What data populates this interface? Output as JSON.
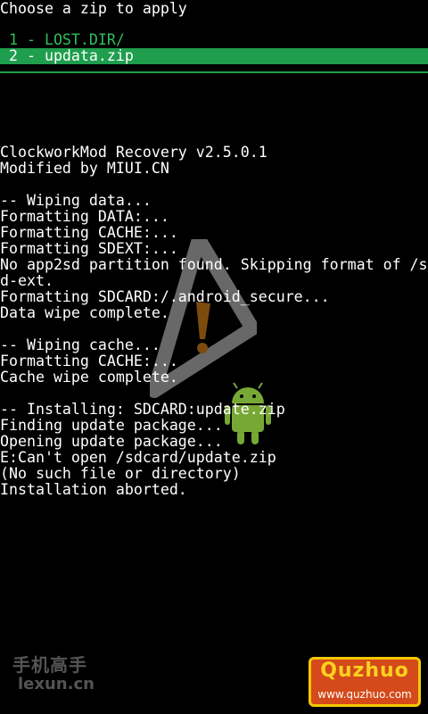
{
  "header": {
    "title": "Choose a zip to apply"
  },
  "menu": {
    "items": [
      {
        "label": " 1 - LOST.DIR/"
      },
      {
        "label": " 2 - updata.zip"
      }
    ],
    "selected_index": 1,
    "colors": {
      "item_text": "#2fbf5c",
      "highlight": "#1f9e4e"
    }
  },
  "log": {
    "lines": [
      "ClockworkMod Recovery v2.5.0.1",
      "Modified by MIUI.CN",
      "",
      "-- Wiping data...",
      "Formatting DATA:...",
      "Formatting CACHE:...",
      "Formatting SDEXT:...",
      "No app2sd partition found. Skipping format of /s",
      "d-ext.",
      "Formatting SDCARD:/.android_secure...",
      "Data wipe complete.",
      "",
      "-- Wiping cache...",
      "Formatting CACHE:...",
      "Cache wipe complete.",
      "",
      "-- Installing: SDCARD:update.zip",
      "Finding update package...",
      "Opening update package...",
      "E:Can't open /sdcard/update.zip",
      "(No such file or directory)",
      "Installation aborted."
    ]
  },
  "icons": {
    "warning": "warning-triangle-icon",
    "android": "android-robot-icon"
  },
  "watermarks": {
    "left": {
      "line1": "手机高手",
      "line2": "lexun.cn"
    },
    "right": {
      "brand": "Quzhuo",
      "url": "www.quzhuo.com"
    }
  }
}
